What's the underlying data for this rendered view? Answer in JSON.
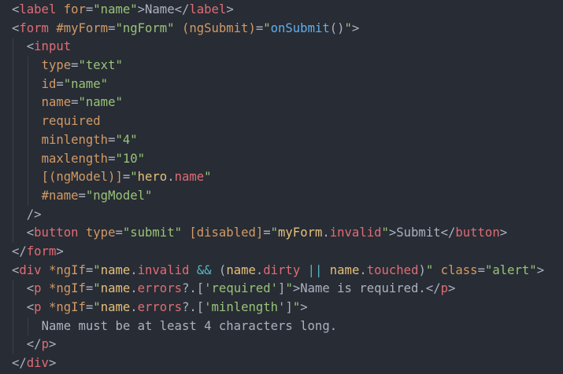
{
  "colors": {
    "background": "#282c34",
    "punctuation": "#abb2bf",
    "tag": "#e06c75",
    "attribute": "#d19a66",
    "string": "#98c379",
    "function": "#61afef",
    "identifier": "#e5c07b",
    "operator": "#56b6c2"
  },
  "lines": [
    {
      "indent": 0,
      "tokens": [
        {
          "t": "punct",
          "v": "<"
        },
        {
          "t": "tag",
          "v": "label"
        },
        {
          "t": "punct",
          "v": " "
        },
        {
          "t": "attr",
          "v": "for"
        },
        {
          "t": "punct",
          "v": "="
        },
        {
          "t": "str",
          "v": "\"name\""
        },
        {
          "t": "punct",
          "v": ">Name</"
        },
        {
          "t": "tag",
          "v": "label"
        },
        {
          "t": "punct",
          "v": ">"
        }
      ]
    },
    {
      "indent": 0,
      "tokens": [
        {
          "t": "punct",
          "v": "<"
        },
        {
          "t": "tag",
          "v": "form"
        },
        {
          "t": "punct",
          "v": " "
        },
        {
          "t": "attr",
          "v": "#myForm"
        },
        {
          "t": "punct",
          "v": "="
        },
        {
          "t": "str",
          "v": "\"ngForm\""
        },
        {
          "t": "punct",
          "v": " "
        },
        {
          "t": "attr",
          "v": "(ngSubmit)"
        },
        {
          "t": "punct",
          "v": "="
        },
        {
          "t": "str",
          "v": "\""
        },
        {
          "t": "fn",
          "v": "onSubmit"
        },
        {
          "t": "punct",
          "v": "()"
        },
        {
          "t": "str",
          "v": "\""
        },
        {
          "t": "punct",
          "v": ">"
        }
      ]
    },
    {
      "indent": 1,
      "tokens": [
        {
          "t": "punct",
          "v": "<"
        },
        {
          "t": "tag",
          "v": "input"
        }
      ]
    },
    {
      "indent": 2,
      "tokens": [
        {
          "t": "attr",
          "v": "type"
        },
        {
          "t": "punct",
          "v": "="
        },
        {
          "t": "str",
          "v": "\"text\""
        }
      ]
    },
    {
      "indent": 2,
      "tokens": [
        {
          "t": "attr",
          "v": "id"
        },
        {
          "t": "punct",
          "v": "="
        },
        {
          "t": "str",
          "v": "\"name\""
        }
      ]
    },
    {
      "indent": 2,
      "tokens": [
        {
          "t": "attr",
          "v": "name"
        },
        {
          "t": "punct",
          "v": "="
        },
        {
          "t": "str",
          "v": "\"name\""
        }
      ]
    },
    {
      "indent": 2,
      "tokens": [
        {
          "t": "attr",
          "v": "required"
        }
      ]
    },
    {
      "indent": 2,
      "tokens": [
        {
          "t": "attr",
          "v": "minlength"
        },
        {
          "t": "punct",
          "v": "="
        },
        {
          "t": "str",
          "v": "\"4\""
        }
      ]
    },
    {
      "indent": 2,
      "tokens": [
        {
          "t": "attr",
          "v": "maxlength"
        },
        {
          "t": "punct",
          "v": "="
        },
        {
          "t": "str",
          "v": "\"10\""
        }
      ]
    },
    {
      "indent": 2,
      "tokens": [
        {
          "t": "attr",
          "v": "[(ngModel)]"
        },
        {
          "t": "punct",
          "v": "="
        },
        {
          "t": "str",
          "v": "\""
        },
        {
          "t": "ident",
          "v": "hero"
        },
        {
          "t": "punct",
          "v": "."
        },
        {
          "t": "tag",
          "v": "name"
        },
        {
          "t": "str",
          "v": "\""
        }
      ]
    },
    {
      "indent": 2,
      "tokens": [
        {
          "t": "attr",
          "v": "#name"
        },
        {
          "t": "punct",
          "v": "="
        },
        {
          "t": "str",
          "v": "\"ngModel\""
        }
      ]
    },
    {
      "indent": 1,
      "tokens": [
        {
          "t": "punct",
          "v": "/>"
        }
      ]
    },
    {
      "indent": 1,
      "tokens": [
        {
          "t": "punct",
          "v": "<"
        },
        {
          "t": "tag",
          "v": "button"
        },
        {
          "t": "punct",
          "v": " "
        },
        {
          "t": "attr",
          "v": "type"
        },
        {
          "t": "punct",
          "v": "="
        },
        {
          "t": "str",
          "v": "\"submit\""
        },
        {
          "t": "punct",
          "v": " "
        },
        {
          "t": "attr",
          "v": "[disabled]"
        },
        {
          "t": "punct",
          "v": "="
        },
        {
          "t": "str",
          "v": "\""
        },
        {
          "t": "ident",
          "v": "myForm"
        },
        {
          "t": "punct",
          "v": "."
        },
        {
          "t": "tag",
          "v": "invalid"
        },
        {
          "t": "str",
          "v": "\""
        },
        {
          "t": "punct",
          "v": ">Submit</"
        },
        {
          "t": "tag",
          "v": "button"
        },
        {
          "t": "punct",
          "v": ">"
        }
      ]
    },
    {
      "indent": 0,
      "tokens": [
        {
          "t": "punct",
          "v": "</"
        },
        {
          "t": "tag",
          "v": "form"
        },
        {
          "t": "punct",
          "v": ">"
        }
      ]
    },
    {
      "indent": 0,
      "tokens": [
        {
          "t": "punct",
          "v": "<"
        },
        {
          "t": "tag",
          "v": "div"
        },
        {
          "t": "punct",
          "v": " "
        },
        {
          "t": "attr",
          "v": "*ngIf"
        },
        {
          "t": "punct",
          "v": "="
        },
        {
          "t": "str",
          "v": "\""
        },
        {
          "t": "ident",
          "v": "name"
        },
        {
          "t": "punct",
          "v": "."
        },
        {
          "t": "tag",
          "v": "invalid"
        },
        {
          "t": "punct",
          "v": " "
        },
        {
          "t": "op",
          "v": "&&"
        },
        {
          "t": "punct",
          "v": " ("
        },
        {
          "t": "ident",
          "v": "name"
        },
        {
          "t": "punct",
          "v": "."
        },
        {
          "t": "tag",
          "v": "dirty"
        },
        {
          "t": "punct",
          "v": " "
        },
        {
          "t": "op",
          "v": "||"
        },
        {
          "t": "punct",
          "v": " "
        },
        {
          "t": "ident",
          "v": "name"
        },
        {
          "t": "punct",
          "v": "."
        },
        {
          "t": "tag",
          "v": "touched"
        },
        {
          "t": "punct",
          "v": ")"
        },
        {
          "t": "str",
          "v": "\""
        },
        {
          "t": "punct",
          "v": " "
        },
        {
          "t": "attr",
          "v": "class"
        },
        {
          "t": "punct",
          "v": "="
        },
        {
          "t": "str",
          "v": "\"alert\""
        },
        {
          "t": "punct",
          "v": ">"
        }
      ]
    },
    {
      "indent": 1,
      "tokens": [
        {
          "t": "punct",
          "v": "<"
        },
        {
          "t": "tag",
          "v": "p"
        },
        {
          "t": "punct",
          "v": " "
        },
        {
          "t": "attr",
          "v": "*ngIf"
        },
        {
          "t": "punct",
          "v": "="
        },
        {
          "t": "str",
          "v": "\""
        },
        {
          "t": "ident",
          "v": "name"
        },
        {
          "t": "punct",
          "v": "."
        },
        {
          "t": "tag",
          "v": "errors"
        },
        {
          "t": "punct",
          "v": "?.["
        },
        {
          "t": "str",
          "v": "'required'"
        },
        {
          "t": "punct",
          "v": "]"
        },
        {
          "t": "str",
          "v": "\""
        },
        {
          "t": "punct",
          "v": ">Name is required.</"
        },
        {
          "t": "tag",
          "v": "p"
        },
        {
          "t": "punct",
          "v": ">"
        }
      ]
    },
    {
      "indent": 1,
      "tokens": [
        {
          "t": "punct",
          "v": "<"
        },
        {
          "t": "tag",
          "v": "p"
        },
        {
          "t": "punct",
          "v": " "
        },
        {
          "t": "attr",
          "v": "*ngIf"
        },
        {
          "t": "punct",
          "v": "="
        },
        {
          "t": "str",
          "v": "\""
        },
        {
          "t": "ident",
          "v": "name"
        },
        {
          "t": "punct",
          "v": "."
        },
        {
          "t": "tag",
          "v": "errors"
        },
        {
          "t": "punct",
          "v": "?.["
        },
        {
          "t": "str",
          "v": "'minlength'"
        },
        {
          "t": "punct",
          "v": "]"
        },
        {
          "t": "str",
          "v": "\""
        },
        {
          "t": "punct",
          "v": ">"
        }
      ]
    },
    {
      "indent": 2,
      "tokens": [
        {
          "t": "punct",
          "v": "Name must be at least 4 characters long."
        }
      ]
    },
    {
      "indent": 1,
      "tokens": [
        {
          "t": "punct",
          "v": "</"
        },
        {
          "t": "tag",
          "v": "p"
        },
        {
          "t": "punct",
          "v": ">"
        }
      ]
    },
    {
      "indent": 0,
      "tokens": [
        {
          "t": "punct",
          "v": "</"
        },
        {
          "t": "tag",
          "v": "div"
        },
        {
          "t": "punct",
          "v": ">"
        }
      ]
    }
  ]
}
